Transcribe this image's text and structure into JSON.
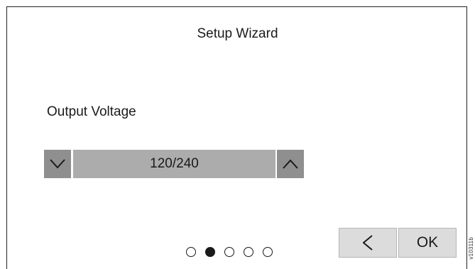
{
  "wizard": {
    "title": "Setup Wizard",
    "field_label": "Output Voltage",
    "selector": {
      "value": "120/240",
      "decrease_icon": "chevron-down-icon",
      "increase_icon": "chevron-up-icon"
    },
    "pager": {
      "total_pages": 5,
      "current_page": 2
    },
    "buttons": {
      "back_icon": "chevron-left-icon",
      "ok_label": "OK"
    }
  },
  "figure_code": "v10311b"
}
